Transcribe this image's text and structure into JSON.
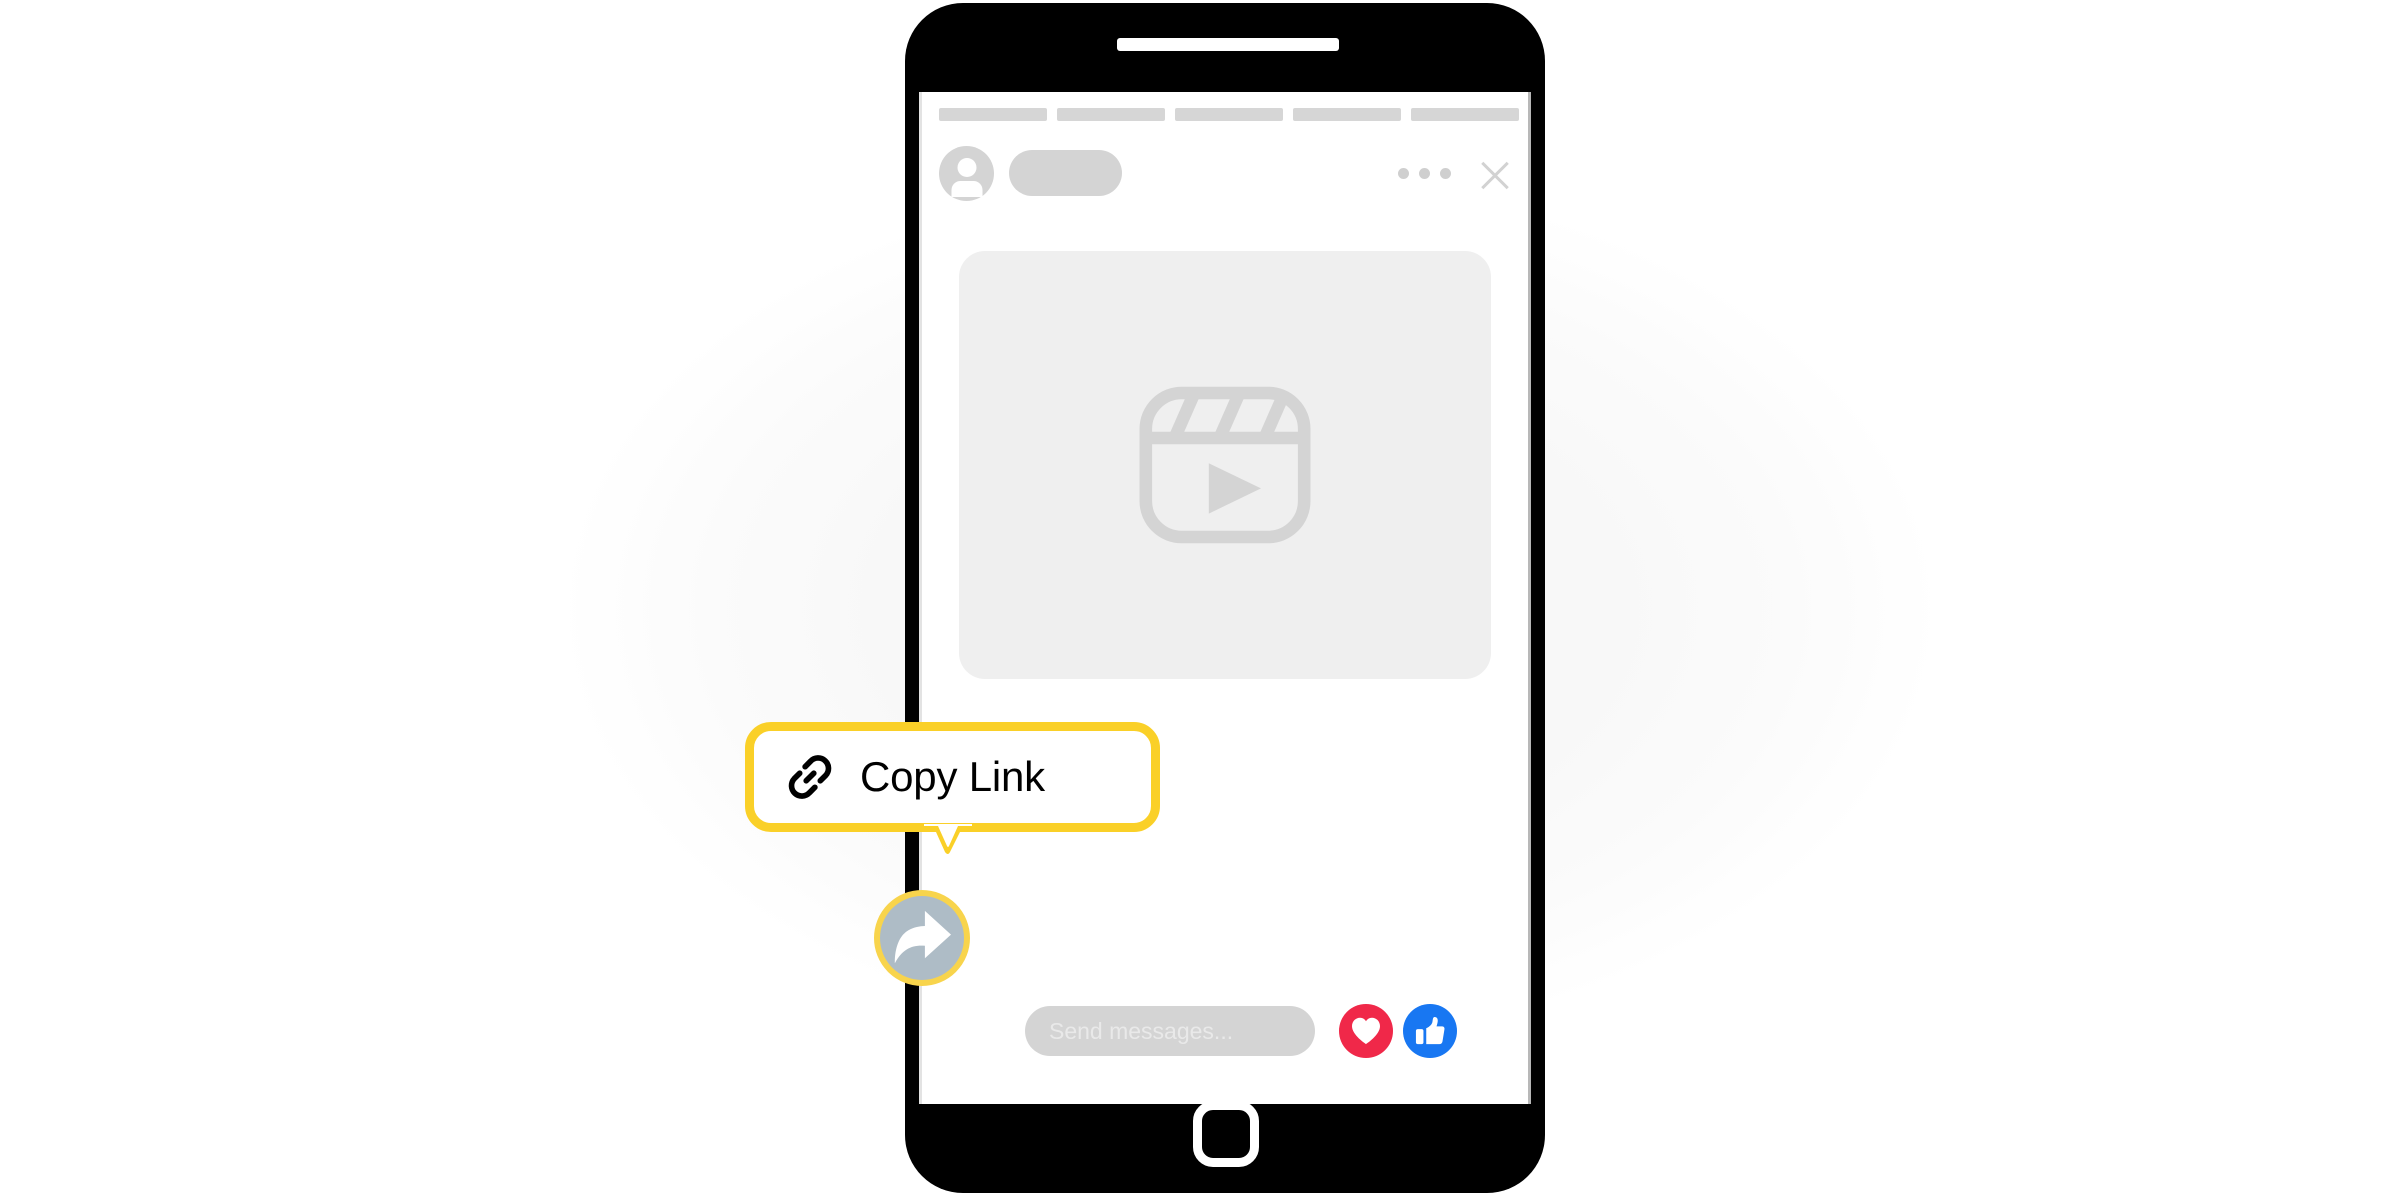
{
  "scene": {
    "title": "Copy Link tooltip on share button",
    "background_color": "#ffffff",
    "ellipse_color": "#f7f7f7"
  },
  "phone": {
    "frame_color": "#000000",
    "screen_color": "#ffffff",
    "speaker": "speaker-slot",
    "home_button": "home-button"
  },
  "app": {
    "nav_skeleton": {
      "count": 5,
      "color": "#d6d6d6"
    },
    "post_header": {
      "avatar_icon": "person-avatar-icon",
      "avatar_color": "#d4d4d4",
      "name_placeholder": "",
      "more_menu_icon": "three-dots-icon",
      "close_icon": "close-x-icon"
    },
    "media": {
      "placeholder_icon": "video-reel-icon",
      "card_color": "#efefef",
      "icon_color": "#d4d4d4"
    },
    "composer": {
      "input_placeholder": "Send messages...",
      "input_value": "",
      "input_bg": "#d4d4d4",
      "reactions": [
        {
          "name": "heart",
          "icon": "heart-icon",
          "color": "#f02849"
        },
        {
          "name": "like",
          "icon": "thumbs-up-icon",
          "color": "#1877f2"
        }
      ]
    }
  },
  "highlight": {
    "share_button": {
      "icon": "share-forward-arrow-icon",
      "fill_color": "#aebcc6",
      "ring_color": "#f8d44c",
      "label": "Share"
    },
    "tooltip": {
      "text": "Copy Link",
      "icon": "chain-link-icon",
      "border_color": "#fad028",
      "background_color": "#ffffff",
      "text_color": "#000000"
    }
  }
}
